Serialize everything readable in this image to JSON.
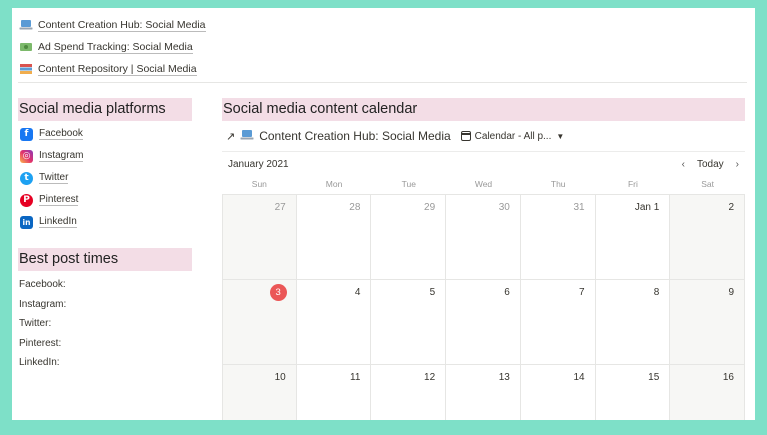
{
  "top_links": [
    {
      "label": "Content Creation Hub: Social Media",
      "icon": "laptop-icon"
    },
    {
      "label": "Ad Spend Tracking: Social Media",
      "icon": "money-icon"
    },
    {
      "label": "Content Repository | Social Media",
      "icon": "books-icon"
    }
  ],
  "platforms": {
    "heading": "Social media platforms",
    "items": [
      {
        "label": "Facebook",
        "icon": "facebook-icon",
        "color": "#1877f2",
        "glyph": "f"
      },
      {
        "label": "Instagram",
        "icon": "instagram-icon",
        "color": "#d6249f",
        "glyph": "◎"
      },
      {
        "label": "Twitter",
        "icon": "twitter-icon",
        "color": "#1da1f2",
        "glyph": "t"
      },
      {
        "label": "Pinterest",
        "icon": "pinterest-icon",
        "color": "#e60023",
        "glyph": "P"
      },
      {
        "label": "LinkedIn",
        "icon": "linkedin-icon",
        "color": "#0a66c2",
        "glyph": "in"
      }
    ]
  },
  "best_times": {
    "heading": "Best post times",
    "items": [
      "Facebook:",
      "Instagram:",
      "Twitter:",
      "Pinterest:",
      "LinkedIn:"
    ]
  },
  "calendar": {
    "heading": "Social media content calendar",
    "db_title": "Content Creation Hub: Social Media",
    "view_label": "Calendar - All p...",
    "month": "January 2021",
    "today_label": "Today",
    "weekdays": [
      "Sun",
      "Mon",
      "Tue",
      "Wed",
      "Thu",
      "Fri",
      "Sat"
    ],
    "days": [
      "27",
      "28",
      "29",
      "30",
      "31",
      "Jan 1",
      "2",
      "3",
      "4",
      "5",
      "6",
      "7",
      "8",
      "9",
      "10",
      "11",
      "12",
      "13",
      "14",
      "15",
      "16"
    ],
    "muted_days": [
      "27",
      "28",
      "29",
      "30",
      "31"
    ],
    "today": "3",
    "accent_color": "#eb5757",
    "heading_bg": "#f3dde6"
  }
}
